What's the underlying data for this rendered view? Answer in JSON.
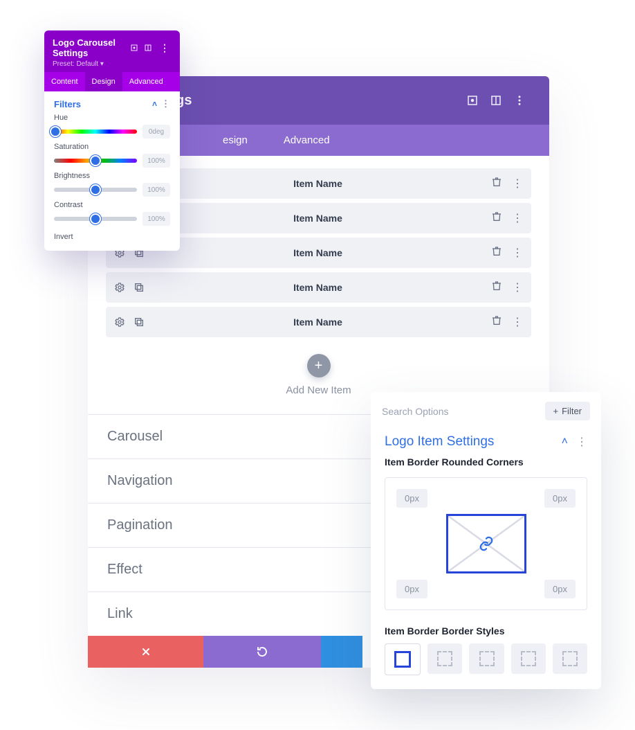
{
  "main": {
    "title_suffix": "usel Settings",
    "tabs": {
      "design": "esign",
      "advanced": "Advanced"
    },
    "items": [
      {
        "name": "Item Name"
      },
      {
        "name": "Item Name"
      },
      {
        "name": "Item Name"
      },
      {
        "name": "Item Name"
      },
      {
        "name": "Item Name"
      }
    ],
    "add_label": "Add New Item",
    "sections": [
      "Carousel",
      "Navigation",
      "Pagination",
      "Effect",
      "Link"
    ]
  },
  "filters": {
    "title": "Logo Carousel Settings",
    "preset": "Preset: Default",
    "tabs": [
      "Content",
      "Design",
      "Advanced"
    ],
    "active_tab": 1,
    "section_title": "Filters",
    "controls": [
      {
        "label": "Hue",
        "value": "0deg",
        "pos": 2,
        "track": "hue"
      },
      {
        "label": "Saturation",
        "value": "100%",
        "pos": 50,
        "track": "sat"
      },
      {
        "label": "Brightness",
        "value": "100%",
        "pos": 50,
        "track": "gray"
      },
      {
        "label": "Contrast",
        "value": "100%",
        "pos": 50,
        "track": "gray"
      }
    ],
    "invert_label": "Invert"
  },
  "item_panel": {
    "search_placeholder": "Search Options",
    "filter_label": "Filter",
    "title": "Logo Item Settings",
    "rounded_label": "Item Border Rounded Corners",
    "corners": {
      "tl": "0px",
      "tr": "0px",
      "bl": "0px",
      "br": "0px"
    },
    "styles_label": "Item Border Border Styles"
  }
}
